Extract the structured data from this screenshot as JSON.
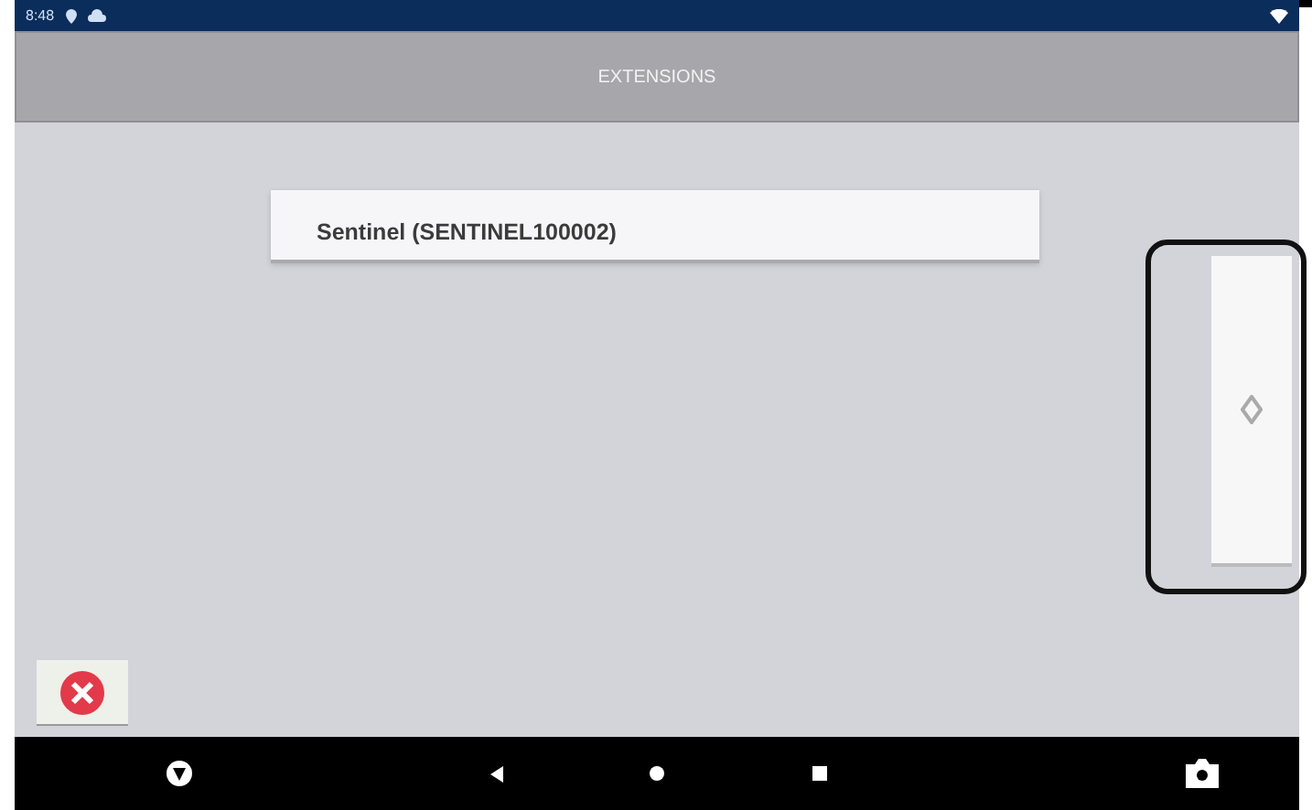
{
  "status_bar": {
    "time": "8:48"
  },
  "header": {
    "title": "EXTENSIONS"
  },
  "field": {
    "value": "Sentinel (SENTINEL100002)"
  }
}
